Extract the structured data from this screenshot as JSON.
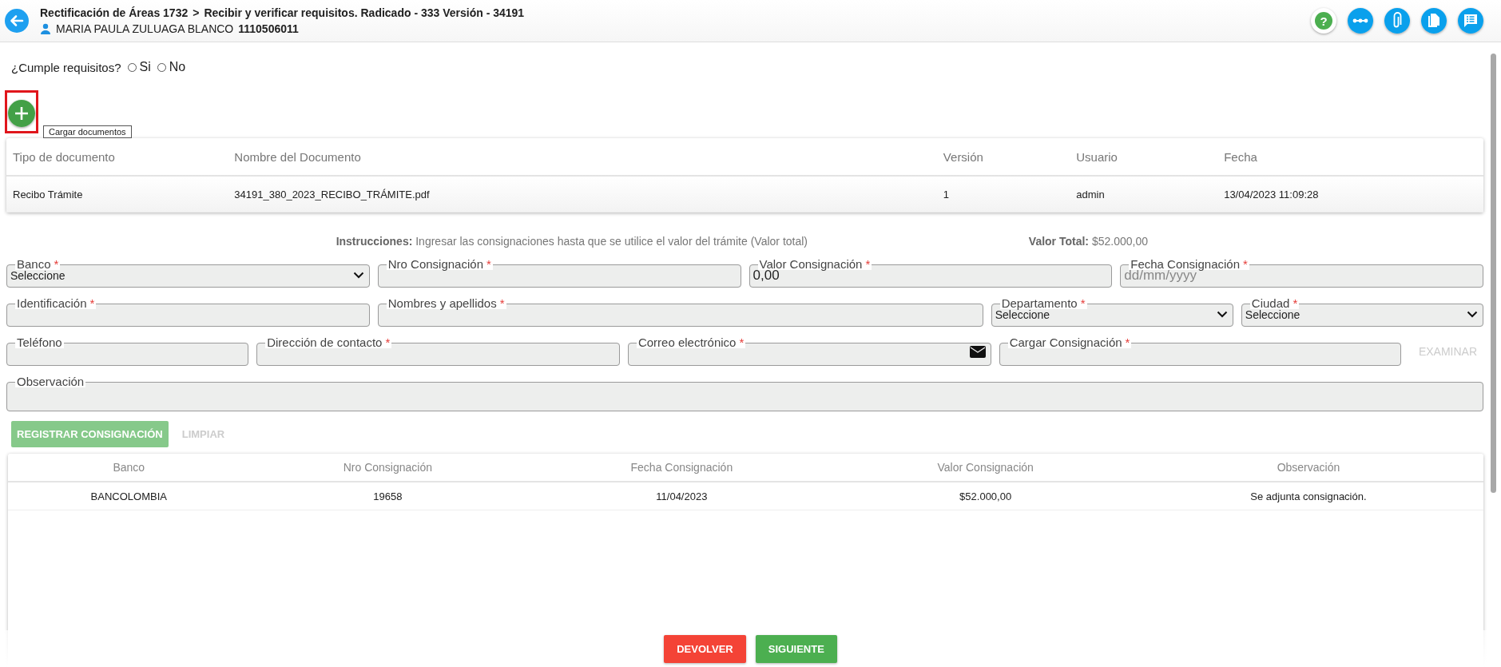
{
  "header": {
    "title": "Rectificación de Áreas 1732",
    "separator": ">",
    "subtitle": "Recibir y verificar requisitos. Radicado - 333 Versión - 34191",
    "user_name": "MARIA PAULA ZULUAGA BLANCO",
    "user_id": "1110506011",
    "help": "?"
  },
  "requirements": {
    "question": "¿Cumple requisitos?",
    "options": [
      {
        "label": "Si",
        "selected": false
      },
      {
        "label": "No",
        "selected": false
      }
    ]
  },
  "upload": {
    "tooltip": "Cargar documentos",
    "highlighted": true
  },
  "documents": {
    "columns": [
      "Tipo de documento",
      "Nombre del Documento",
      "Versión",
      "Usuario",
      "Fecha"
    ],
    "rows": [
      [
        "Recibo Trámite",
        "34191_380_2023_RECIBO_TRÁMITE.pdf",
        "1",
        "admin",
        "13/04/2023 11:09:28"
      ]
    ]
  },
  "instructions": {
    "label": "Instrucciones:",
    "text": "Ingresar las consignaciones hasta que se utilice el valor del trámite (Valor total)",
    "total_label": "Valor Total:",
    "total_value": "$52.000,00"
  },
  "form": {
    "rows": [
      [
        {
          "label": "Banco",
          "mark": "*",
          "kind": "select",
          "value": "Seleccione"
        },
        {
          "label": "Nro Consignación",
          "mark": "*",
          "kind": "text"
        },
        {
          "label": "Valor Consignación",
          "mark": "*",
          "kind": "text",
          "value": "0,00"
        },
        {
          "label": "Fecha Consignación",
          "mark": "*",
          "kind": "text",
          "placeholder": "dd/mm/yyyy"
        }
      ],
      [
        {
          "label": "Identificación",
          "mark": "*",
          "kind": "text"
        },
        {
          "label": "Nombres y apellidos",
          "mark": "*",
          "kind": "text"
        },
        {
          "label": "Departamento",
          "mark": "*",
          "kind": "select",
          "value": "Seleccione"
        },
        {
          "label": "Ciudad",
          "mark": "*",
          "kind": "select",
          "value": "Seleccione"
        }
      ],
      [
        {
          "label": "Teléfono",
          "kind": "text"
        },
        {
          "label": "Dirección de contacto",
          "mark": "*",
          "kind": "text"
        },
        {
          "label": "Correo electrónico",
          "mark": "*",
          "kind": "email"
        },
        {
          "label": "Cargar Consignación",
          "mark": "*",
          "kind": "file",
          "button": "EXAMINAR",
          "disabled": true
        }
      ],
      [
        {
          "label": "Observación",
          "kind": "textarea"
        }
      ]
    ],
    "buttons": [
      {
        "label": "REGISTRAR CONSIGNACIÓN",
        "kind": "primary",
        "disabled": true
      },
      {
        "label": "LIMPIAR",
        "kind": "flat",
        "disabled": true
      }
    ]
  },
  "payments": {
    "columns": [
      "Banco",
      "Nro Consignación",
      "Fecha Consignación",
      "Valor Consignación",
      "Observación"
    ],
    "rows": [
      [
        "BANCOLOMBIA",
        "19658",
        "11/04/2023",
        "$52.000,00",
        "Se adjunta consignación."
      ]
    ]
  },
  "actions": [
    {
      "label": "DEVOLVER",
      "kind": "danger"
    },
    {
      "label": "SIGUIENTE",
      "kind": "success"
    }
  ]
}
